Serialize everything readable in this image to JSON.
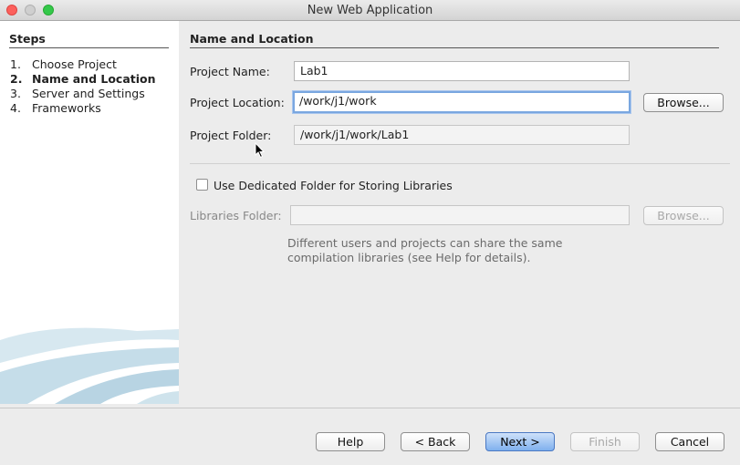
{
  "window": {
    "title": "New Web Application"
  },
  "steps": {
    "heading": "Steps",
    "items": [
      {
        "num": "1.",
        "label": "Choose Project"
      },
      {
        "num": "2.",
        "label": "Name and Location"
      },
      {
        "num": "3.",
        "label": "Server and Settings"
      },
      {
        "num": "4.",
        "label": "Frameworks"
      }
    ],
    "active_index": 1
  },
  "form": {
    "section_title": "Name and Location",
    "project_name": {
      "label": "Project Name:",
      "value": "Lab1"
    },
    "project_location": {
      "label": "Project Location:",
      "value": "/work/j1/work",
      "browse_label": "Browse..."
    },
    "project_folder": {
      "label": "Project Folder:",
      "value": "/work/j1/work/Lab1"
    },
    "dedicated_folder": {
      "label": "Use Dedicated Folder for Storing Libraries",
      "checked": false
    },
    "libraries_folder": {
      "label": "Libraries Folder:",
      "value": "",
      "browse_label": "Browse..."
    },
    "hint_line1": "Different users and projects can share the same",
    "hint_line2": "compilation libraries (see Help for details)."
  },
  "buttons": {
    "help": "Help",
    "back": "< Back",
    "next": "Next >",
    "finish": "Finish",
    "cancel": "Cancel"
  },
  "colors": {
    "primary_button": "#7fb0ee",
    "focus_ring": "#7aa7e0",
    "swoosh": "#c5dde9"
  }
}
